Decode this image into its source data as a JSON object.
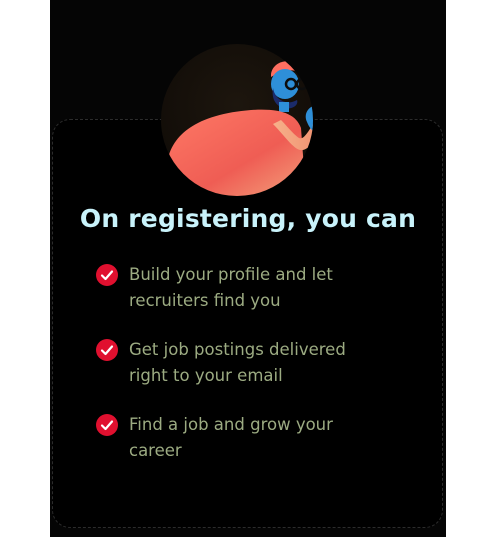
{
  "heading": "On registering, you can",
  "benefits": [
    {
      "line1": "Build your profile and let",
      "line2": "recruiters find you"
    },
    {
      "line1": "Get job postings delivered",
      "line2": "right to your email"
    },
    {
      "line1": "Find a job and grow your",
      "line2": "career"
    }
  ],
  "icons": {
    "check": "check-circle-icon",
    "illustration": "waving-person-illustration"
  },
  "colors": {
    "background": "#050505",
    "heading": "#c9f3fb",
    "benefit_text": "#9cab82",
    "check_red": "#e0102f",
    "sweater": "#f06a5a",
    "skin": "#2e8fd8"
  }
}
